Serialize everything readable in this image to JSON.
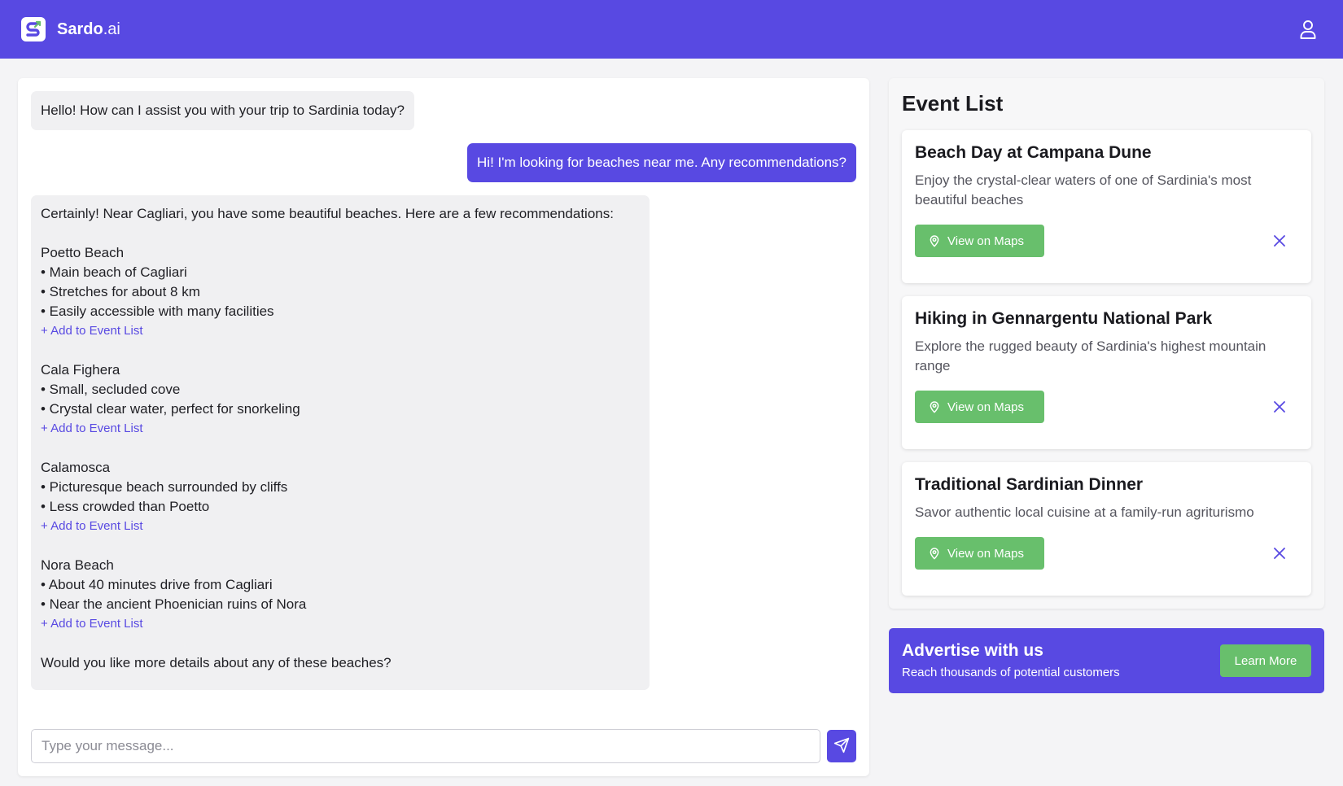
{
  "header": {
    "brand_bold": "Sardo",
    "brand_suffix": ".ai",
    "logo_icon": "sardo-logo-icon",
    "user_icon": "user-icon"
  },
  "chat": {
    "greeting": "Hello! How can I assist you with your trip to Sardinia today?",
    "user_message": "Hi! I'm looking for beaches near me. Any recommendations?",
    "response": {
      "intro": "Certainly! Near Cagliari, you have some beautiful beaches. Here are a few recommendations:",
      "beaches": [
        {
          "name": "Poetto Beach",
          "points": [
            "• Main beach of Cagliari",
            "• Stretches for about 8 km",
            "• Easily accessible with many facilities"
          ],
          "link": "+ Add to Event List"
        },
        {
          "name": "Cala Fighera",
          "points": [
            "• Small, secluded cove",
            "• Crystal clear water, perfect for snorkeling"
          ],
          "link": "+ Add to Event List"
        },
        {
          "name": "Calamosca",
          "points": [
            "• Picturesque beach surrounded by cliffs",
            "• Less crowded than Poetto"
          ],
          "link": "+ Add to Event List"
        },
        {
          "name": "Nora Beach",
          "points": [
            "• About 40 minutes drive from Cagliari",
            "• Near the ancient Phoenician ruins of Nora"
          ],
          "link": "+ Add to Event List"
        }
      ],
      "closing": "Would you like more details about any of these beaches?"
    },
    "input_placeholder": "Type your message...",
    "input_value": "",
    "send_icon": "send-icon"
  },
  "events": {
    "title": "Event List",
    "items": [
      {
        "title": "Beach Day at Campana Dune",
        "description": "Enjoy the crystal-clear waters of one of Sardinia's most beautiful beaches",
        "button": "View on Maps"
      },
      {
        "title": "Hiking in Gennargentu National Park",
        "description": "Explore the rugged beauty of Sardinia's highest mountain range",
        "button": "View on Maps"
      },
      {
        "title": "Traditional Sardinian Dinner",
        "description": "Savor authentic local cuisine at a family-run agriturismo",
        "button": "View on Maps"
      }
    ]
  },
  "ad": {
    "title": "Advertise with us",
    "subtitle": "Reach thousands of potential customers",
    "button": "Learn More"
  },
  "colors": {
    "primary": "#5849e2",
    "green": "#68bf6c",
    "background": "#f4f4f6"
  }
}
